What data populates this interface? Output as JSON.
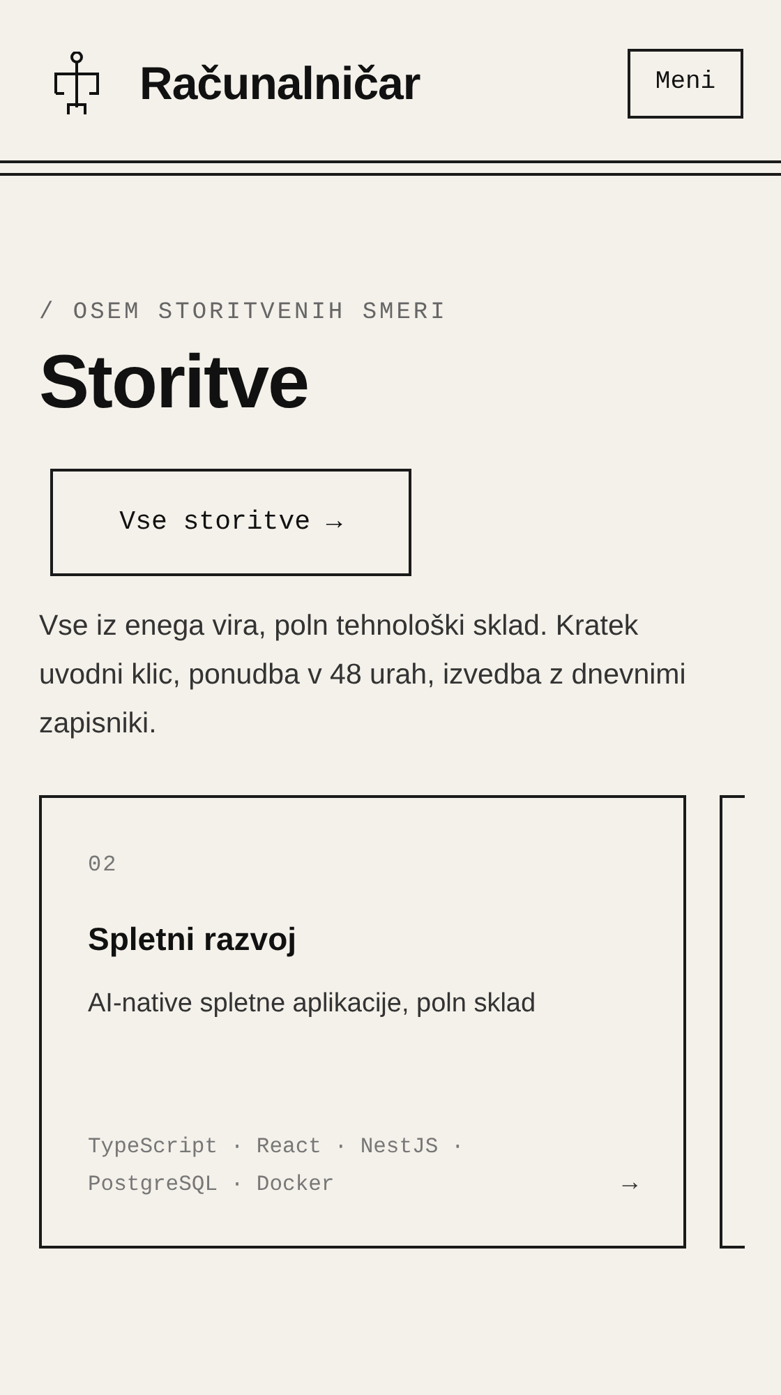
{
  "header": {
    "brand": "Računalničar",
    "menu_button": "Meni"
  },
  "section": {
    "eyebrow": "/ OSEM STORITVENIH SMERI",
    "title": "Storitve",
    "all_button": "Vse storitve →",
    "intro": "Vse iz enega vira, poln tehnološki sklad. Kratek uvodni klic, ponudba v 48 urah, izvedba z dnevnimi zapisniki."
  },
  "cards": [
    {
      "kind": "full",
      "number": "02",
      "title": "Spletni razvoj",
      "description": "AI-native spletne aplikacije, poln sklad",
      "stack": "TypeScript · React · NestJS · PostgreSQL · Docker",
      "arrow": "→"
    },
    {
      "kind": "cut"
    }
  ]
}
